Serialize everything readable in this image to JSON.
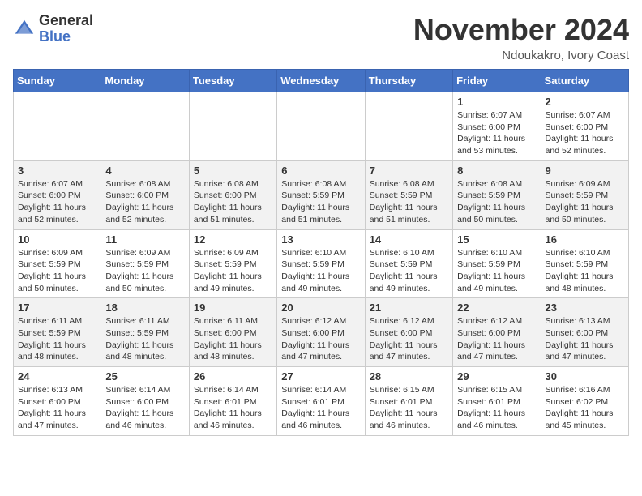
{
  "header": {
    "logo_general": "General",
    "logo_blue": "Blue",
    "month_title": "November 2024",
    "location": "Ndoukakro, Ivory Coast"
  },
  "weekdays": [
    "Sunday",
    "Monday",
    "Tuesday",
    "Wednesday",
    "Thursday",
    "Friday",
    "Saturday"
  ],
  "weeks": [
    [
      {
        "day": "",
        "info": ""
      },
      {
        "day": "",
        "info": ""
      },
      {
        "day": "",
        "info": ""
      },
      {
        "day": "",
        "info": ""
      },
      {
        "day": "",
        "info": ""
      },
      {
        "day": "1",
        "info": "Sunrise: 6:07 AM\nSunset: 6:00 PM\nDaylight: 11 hours\nand 53 minutes."
      },
      {
        "day": "2",
        "info": "Sunrise: 6:07 AM\nSunset: 6:00 PM\nDaylight: 11 hours\nand 52 minutes."
      }
    ],
    [
      {
        "day": "3",
        "info": "Sunrise: 6:07 AM\nSunset: 6:00 PM\nDaylight: 11 hours\nand 52 minutes."
      },
      {
        "day": "4",
        "info": "Sunrise: 6:08 AM\nSunset: 6:00 PM\nDaylight: 11 hours\nand 52 minutes."
      },
      {
        "day": "5",
        "info": "Sunrise: 6:08 AM\nSunset: 6:00 PM\nDaylight: 11 hours\nand 51 minutes."
      },
      {
        "day": "6",
        "info": "Sunrise: 6:08 AM\nSunset: 5:59 PM\nDaylight: 11 hours\nand 51 minutes."
      },
      {
        "day": "7",
        "info": "Sunrise: 6:08 AM\nSunset: 5:59 PM\nDaylight: 11 hours\nand 51 minutes."
      },
      {
        "day": "8",
        "info": "Sunrise: 6:08 AM\nSunset: 5:59 PM\nDaylight: 11 hours\nand 50 minutes."
      },
      {
        "day": "9",
        "info": "Sunrise: 6:09 AM\nSunset: 5:59 PM\nDaylight: 11 hours\nand 50 minutes."
      }
    ],
    [
      {
        "day": "10",
        "info": "Sunrise: 6:09 AM\nSunset: 5:59 PM\nDaylight: 11 hours\nand 50 minutes."
      },
      {
        "day": "11",
        "info": "Sunrise: 6:09 AM\nSunset: 5:59 PM\nDaylight: 11 hours\nand 50 minutes."
      },
      {
        "day": "12",
        "info": "Sunrise: 6:09 AM\nSunset: 5:59 PM\nDaylight: 11 hours\nand 49 minutes."
      },
      {
        "day": "13",
        "info": "Sunrise: 6:10 AM\nSunset: 5:59 PM\nDaylight: 11 hours\nand 49 minutes."
      },
      {
        "day": "14",
        "info": "Sunrise: 6:10 AM\nSunset: 5:59 PM\nDaylight: 11 hours\nand 49 minutes."
      },
      {
        "day": "15",
        "info": "Sunrise: 6:10 AM\nSunset: 5:59 PM\nDaylight: 11 hours\nand 49 minutes."
      },
      {
        "day": "16",
        "info": "Sunrise: 6:10 AM\nSunset: 5:59 PM\nDaylight: 11 hours\nand 48 minutes."
      }
    ],
    [
      {
        "day": "17",
        "info": "Sunrise: 6:11 AM\nSunset: 5:59 PM\nDaylight: 11 hours\nand 48 minutes."
      },
      {
        "day": "18",
        "info": "Sunrise: 6:11 AM\nSunset: 5:59 PM\nDaylight: 11 hours\nand 48 minutes."
      },
      {
        "day": "19",
        "info": "Sunrise: 6:11 AM\nSunset: 6:00 PM\nDaylight: 11 hours\nand 48 minutes."
      },
      {
        "day": "20",
        "info": "Sunrise: 6:12 AM\nSunset: 6:00 PM\nDaylight: 11 hours\nand 47 minutes."
      },
      {
        "day": "21",
        "info": "Sunrise: 6:12 AM\nSunset: 6:00 PM\nDaylight: 11 hours\nand 47 minutes."
      },
      {
        "day": "22",
        "info": "Sunrise: 6:12 AM\nSunset: 6:00 PM\nDaylight: 11 hours\nand 47 minutes."
      },
      {
        "day": "23",
        "info": "Sunrise: 6:13 AM\nSunset: 6:00 PM\nDaylight: 11 hours\nand 47 minutes."
      }
    ],
    [
      {
        "day": "24",
        "info": "Sunrise: 6:13 AM\nSunset: 6:00 PM\nDaylight: 11 hours\nand 47 minutes."
      },
      {
        "day": "25",
        "info": "Sunrise: 6:14 AM\nSunset: 6:00 PM\nDaylight: 11 hours\nand 46 minutes."
      },
      {
        "day": "26",
        "info": "Sunrise: 6:14 AM\nSunset: 6:01 PM\nDaylight: 11 hours\nand 46 minutes."
      },
      {
        "day": "27",
        "info": "Sunrise: 6:14 AM\nSunset: 6:01 PM\nDaylight: 11 hours\nand 46 minutes."
      },
      {
        "day": "28",
        "info": "Sunrise: 6:15 AM\nSunset: 6:01 PM\nDaylight: 11 hours\nand 46 minutes."
      },
      {
        "day": "29",
        "info": "Sunrise: 6:15 AM\nSunset: 6:01 PM\nDaylight: 11 hours\nand 46 minutes."
      },
      {
        "day": "30",
        "info": "Sunrise: 6:16 AM\nSunset: 6:02 PM\nDaylight: 11 hours\nand 45 minutes."
      }
    ]
  ]
}
